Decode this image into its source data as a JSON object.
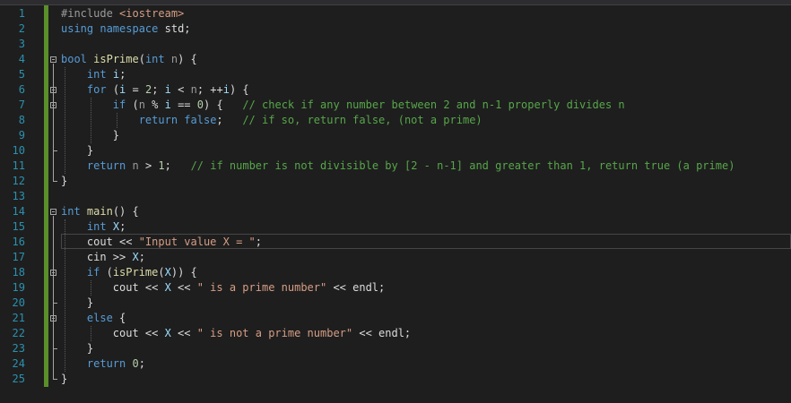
{
  "editor": {
    "colors": {
      "background": "#1e1e1e",
      "line_number": "#2b91af",
      "change_bar": "#5a8f29",
      "keyword": "#569cd6",
      "function": "#dcdcaa",
      "string": "#d69d85",
      "comment": "#57a64a",
      "number": "#b5cea8"
    },
    "lines": [
      {
        "n": "1",
        "tokens": [
          [
            "pp",
            "#include "
          ],
          [
            "inc",
            "<iostream>"
          ]
        ]
      },
      {
        "n": "2",
        "tokens": [
          [
            "kw",
            "using"
          ],
          [
            "txt",
            " "
          ],
          [
            "kw",
            "namespace"
          ],
          [
            "txt",
            " std;"
          ]
        ]
      },
      {
        "n": "3",
        "tokens": []
      },
      {
        "n": "4",
        "tokens": [
          [
            "kw",
            "bool"
          ],
          [
            "txt",
            " "
          ],
          [
            "fn",
            "isPrime"
          ],
          [
            "txt",
            "("
          ],
          [
            "kw",
            "int"
          ],
          [
            "txt",
            " "
          ],
          [
            "prm",
            "n"
          ],
          [
            "txt",
            ") {"
          ]
        ]
      },
      {
        "n": "5",
        "tokens": [
          [
            "txt",
            "    "
          ],
          [
            "kw",
            "int"
          ],
          [
            "txt",
            " "
          ],
          [
            "var",
            "i"
          ],
          [
            "txt",
            ";"
          ]
        ]
      },
      {
        "n": "6",
        "tokens": [
          [
            "txt",
            "    "
          ],
          [
            "kw",
            "for"
          ],
          [
            "txt",
            " ("
          ],
          [
            "var",
            "i"
          ],
          [
            "txt",
            " = "
          ],
          [
            "num",
            "2"
          ],
          [
            "txt",
            "; "
          ],
          [
            "var",
            "i"
          ],
          [
            "txt",
            " < "
          ],
          [
            "prm",
            "n"
          ],
          [
            "txt",
            "; ++"
          ],
          [
            "var",
            "i"
          ],
          [
            "txt",
            ") {"
          ]
        ]
      },
      {
        "n": "7",
        "tokens": [
          [
            "txt",
            "        "
          ],
          [
            "kw",
            "if"
          ],
          [
            "txt",
            " ("
          ],
          [
            "prm",
            "n"
          ],
          [
            "txt",
            " % "
          ],
          [
            "var",
            "i"
          ],
          [
            "txt",
            " == "
          ],
          [
            "num",
            "0"
          ],
          [
            "txt",
            ") {   "
          ],
          [
            "cmt",
            "// check if any number between 2 and n-1 properly divides n"
          ]
        ]
      },
      {
        "n": "8",
        "tokens": [
          [
            "txt",
            "            "
          ],
          [
            "kw",
            "return"
          ],
          [
            "txt",
            " "
          ],
          [
            "kw",
            "false"
          ],
          [
            "txt",
            ";   "
          ],
          [
            "cmt",
            "// if so, return false, (not a prime)"
          ]
        ]
      },
      {
        "n": "9",
        "tokens": [
          [
            "txt",
            "        }"
          ]
        ]
      },
      {
        "n": "10",
        "tokens": [
          [
            "txt",
            "    }"
          ]
        ]
      },
      {
        "n": "11",
        "tokens": [
          [
            "txt",
            "    "
          ],
          [
            "kw",
            "return"
          ],
          [
            "txt",
            " "
          ],
          [
            "prm",
            "n"
          ],
          [
            "txt",
            " > "
          ],
          [
            "num",
            "1"
          ],
          [
            "txt",
            ";   "
          ],
          [
            "cmt",
            "// if number is not divisible by [2 - n-1] and greater than 1, return true (a prime)"
          ]
        ]
      },
      {
        "n": "12",
        "tokens": [
          [
            "txt",
            "}"
          ]
        ]
      },
      {
        "n": "13",
        "tokens": []
      },
      {
        "n": "14",
        "tokens": [
          [
            "kw",
            "int"
          ],
          [
            "txt",
            " "
          ],
          [
            "fn",
            "main"
          ],
          [
            "txt",
            "() {"
          ]
        ]
      },
      {
        "n": "15",
        "tokens": [
          [
            "txt",
            "    "
          ],
          [
            "kw",
            "int"
          ],
          [
            "txt",
            " "
          ],
          [
            "var",
            "X"
          ],
          [
            "txt",
            ";"
          ]
        ]
      },
      {
        "n": "16",
        "tokens": [
          [
            "txt",
            "    cout << "
          ],
          [
            "str",
            "\"Input value X = \""
          ],
          [
            "txt",
            ";"
          ]
        ]
      },
      {
        "n": "17",
        "tokens": [
          [
            "txt",
            "    cin >> "
          ],
          [
            "var",
            "X"
          ],
          [
            "txt",
            ";"
          ]
        ]
      },
      {
        "n": "18",
        "tokens": [
          [
            "txt",
            "    "
          ],
          [
            "kw",
            "if"
          ],
          [
            "txt",
            " ("
          ],
          [
            "fn",
            "isPrime"
          ],
          [
            "txt",
            "("
          ],
          [
            "var",
            "X"
          ],
          [
            "txt",
            ")) {"
          ]
        ]
      },
      {
        "n": "19",
        "tokens": [
          [
            "txt",
            "        cout << "
          ],
          [
            "var",
            "X"
          ],
          [
            "txt",
            " << "
          ],
          [
            "str",
            "\" is a prime number\""
          ],
          [
            "txt",
            " << endl;"
          ]
        ]
      },
      {
        "n": "20",
        "tokens": [
          [
            "txt",
            "    }"
          ]
        ]
      },
      {
        "n": "21",
        "tokens": [
          [
            "txt",
            "    "
          ],
          [
            "kw",
            "else"
          ],
          [
            "txt",
            " {"
          ]
        ]
      },
      {
        "n": "22",
        "tokens": [
          [
            "txt",
            "        cout << "
          ],
          [
            "var",
            "X"
          ],
          [
            "txt",
            " << "
          ],
          [
            "str",
            "\" is not a prime number\""
          ],
          [
            "txt",
            " << endl;"
          ]
        ]
      },
      {
        "n": "23",
        "tokens": [
          [
            "txt",
            "    }"
          ]
        ]
      },
      {
        "n": "24",
        "tokens": [
          [
            "txt",
            "    "
          ],
          [
            "kw",
            "return"
          ],
          [
            "txt",
            " "
          ],
          [
            "num",
            "0"
          ],
          [
            "txt",
            ";"
          ]
        ]
      },
      {
        "n": "25",
        "tokens": [
          [
            "txt",
            "}"
          ]
        ]
      }
    ],
    "fold_markers": [
      "4",
      "6",
      "7",
      "14",
      "18",
      "21"
    ],
    "current_line": "16"
  }
}
